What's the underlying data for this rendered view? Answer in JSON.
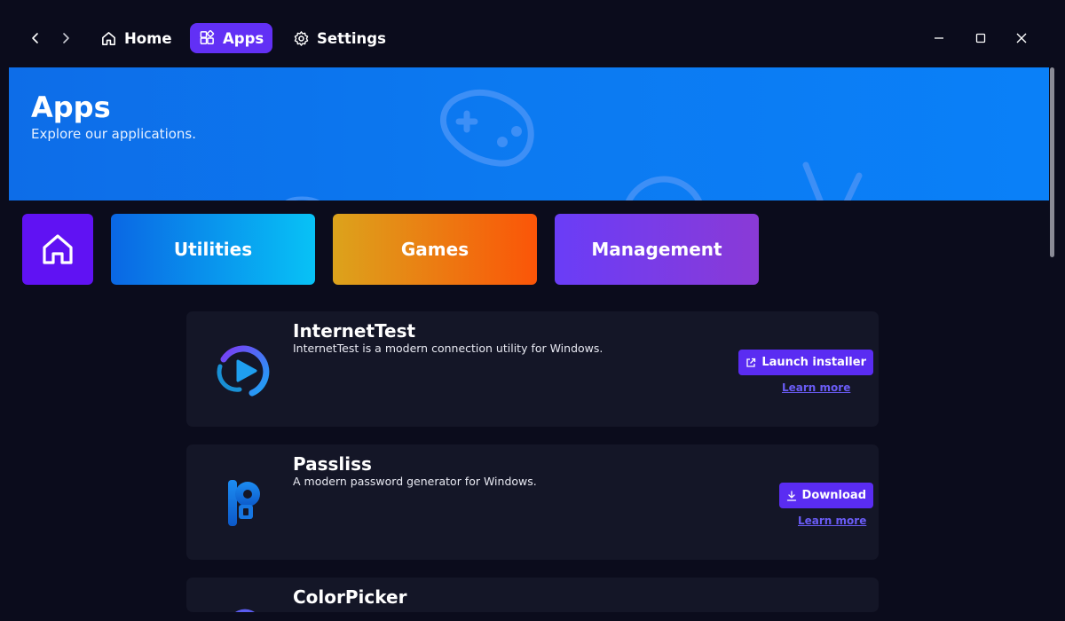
{
  "nav": {
    "back_icon": "chevron-left-icon",
    "forward_icon": "chevron-right-icon",
    "items": [
      {
        "label": "Home",
        "icon": "home-icon",
        "active": false
      },
      {
        "label": "Apps",
        "icon": "apps-icon",
        "active": true
      },
      {
        "label": "Settings",
        "icon": "gear-icon",
        "active": false
      }
    ],
    "accent": "#6230f5"
  },
  "window_controls": [
    "minimize-icon",
    "maximize-icon",
    "close-icon"
  ],
  "hero": {
    "title": "Apps",
    "subtitle": "Explore our applications.",
    "background": "#0c7af1"
  },
  "categories": [
    {
      "label": "",
      "icon": "home-icon",
      "color": "#6012f3"
    },
    {
      "label": "Utilities",
      "colors": [
        "#0a67e4",
        "#08c2f6"
      ]
    },
    {
      "label": "Games",
      "colors": [
        "#dca31c",
        "#fb5508"
      ]
    },
    {
      "label": "Management",
      "colors": [
        "#6a3df7",
        "#8a3ad6"
      ]
    }
  ],
  "apps": [
    {
      "name": "InternetTest",
      "description": "InternetTest is a modern connection utility for Windows.",
      "action_label": "Launch installer",
      "action_icon": "external-link-icon",
      "link_label": "Learn more"
    },
    {
      "name": "Passliss",
      "description": "A modern password generator for Windows.",
      "action_label": "Download",
      "action_icon": "download-icon",
      "link_label": "Learn more"
    },
    {
      "name": "ColorPicker",
      "description": ""
    }
  ]
}
